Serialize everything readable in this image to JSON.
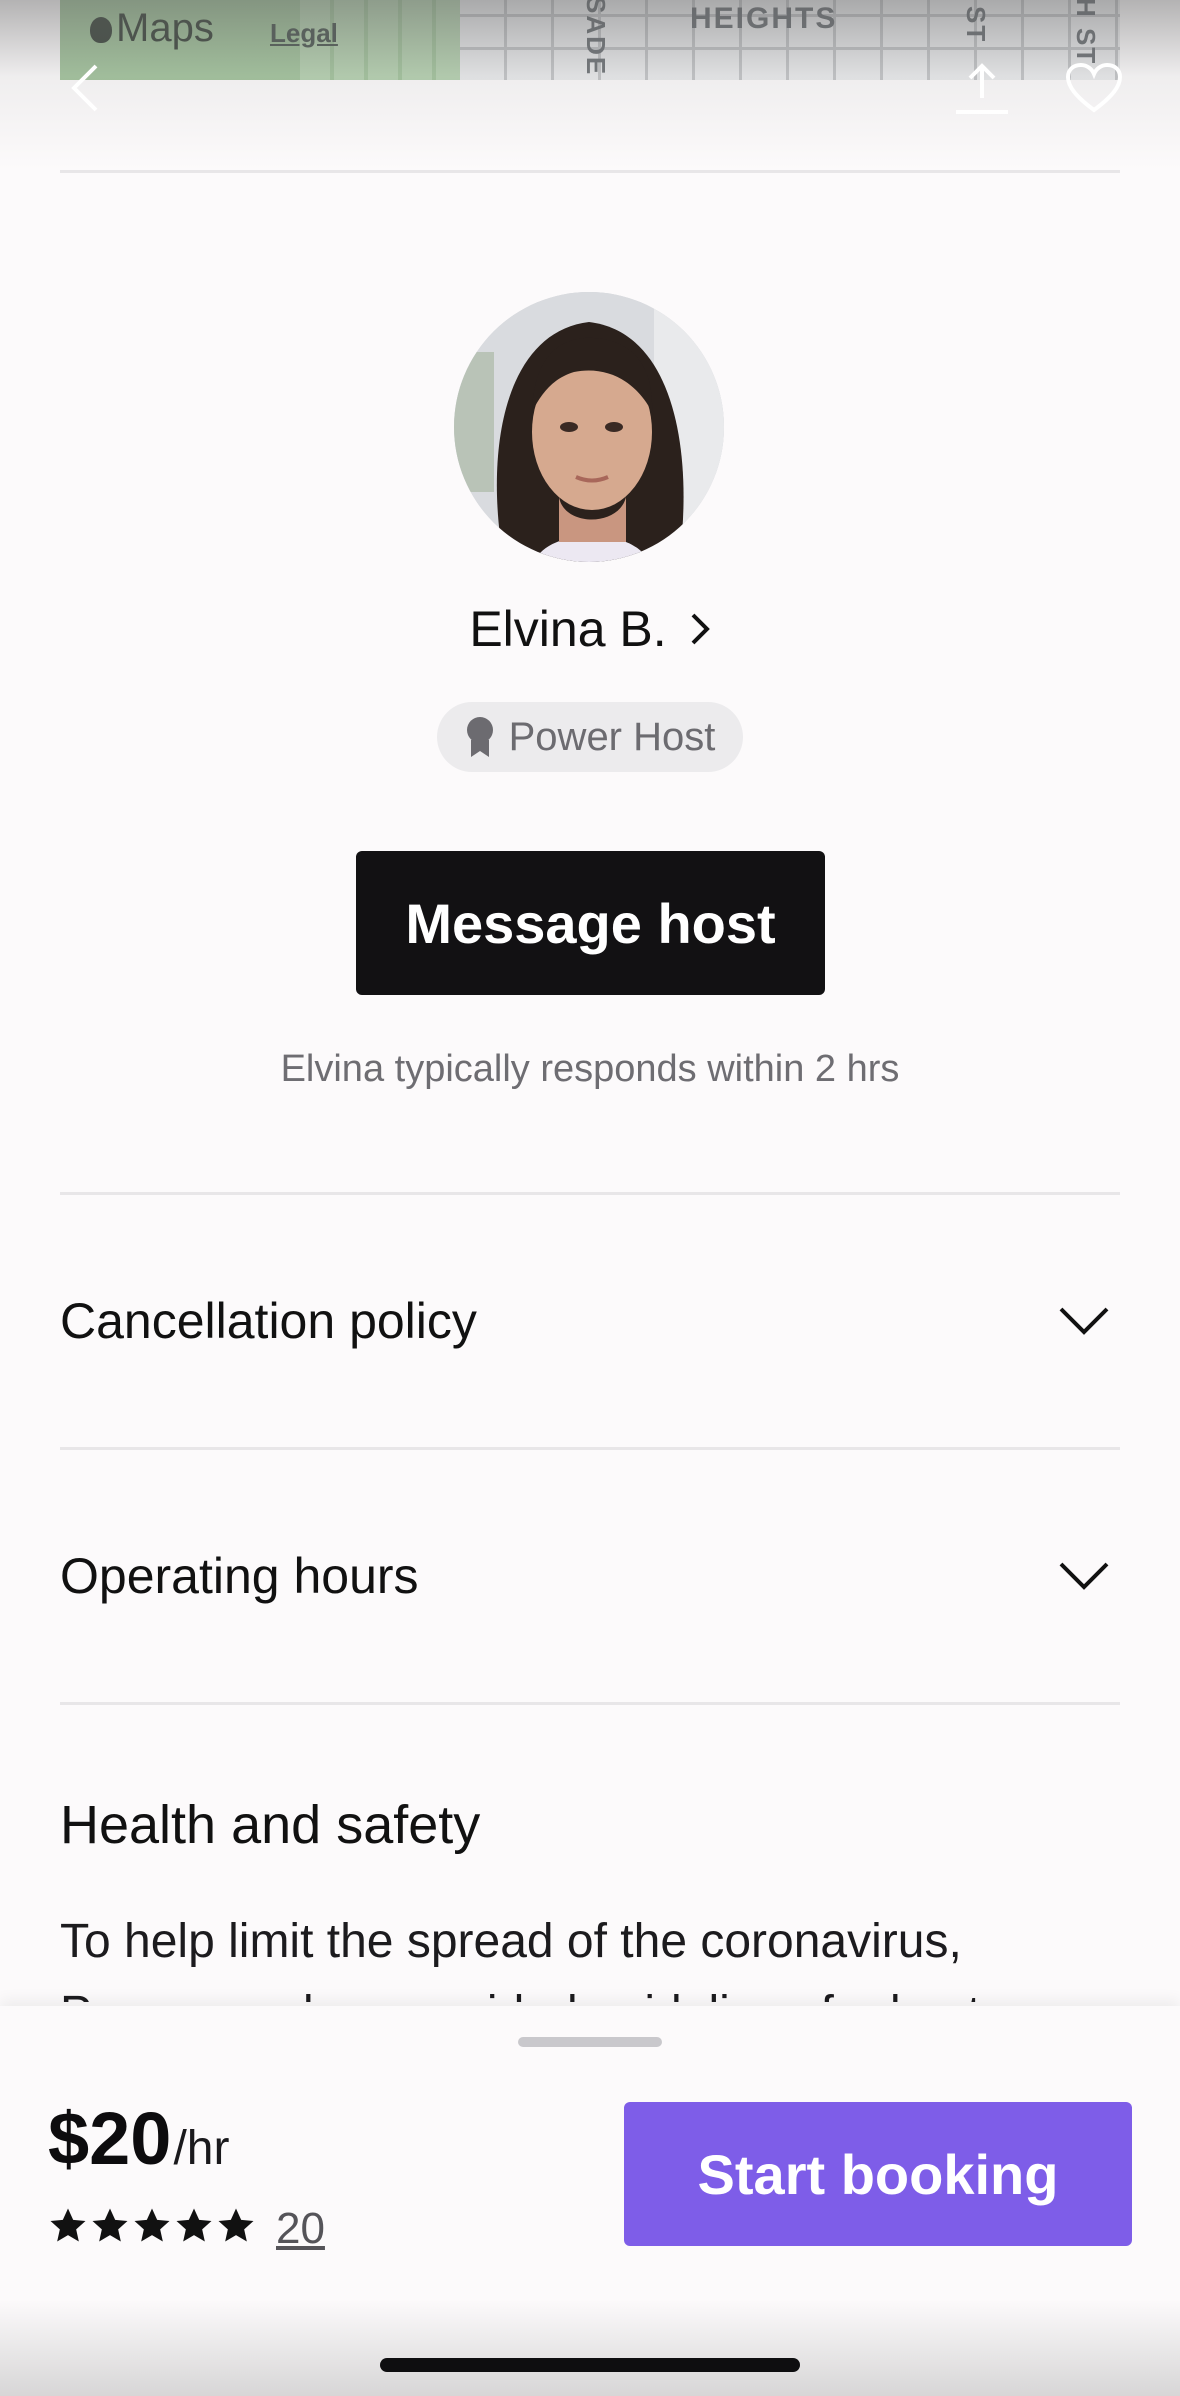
{
  "map": {
    "logo_text": "Maps",
    "legal_link": "Legal",
    "label_heights": "HEIGHTS",
    "label_sade": "SADE",
    "label_st": "ST",
    "label_hst": "H ST"
  },
  "host": {
    "name": "Elvina B.",
    "badge": "Power Host",
    "message_button": "Message host",
    "response_note": "Elvina typically responds within 2 hrs"
  },
  "sections": {
    "cancellation": "Cancellation policy",
    "hours": "Operating hours",
    "health_title": "Health and safety",
    "health_body": "To help limit the spread of the coronavirus, Peerspace has provided guidelines for hosts"
  },
  "booking": {
    "price": "$20",
    "unit": "/hr",
    "rating_stars": 5,
    "review_count": "20",
    "button": "Start booking"
  },
  "colors": {
    "accent": "#7e5de8",
    "dark_button": "#121113"
  }
}
